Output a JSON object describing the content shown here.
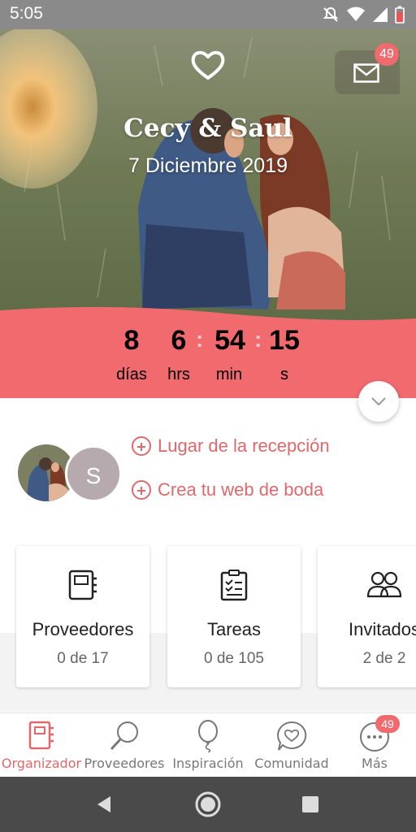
{
  "status_bar": {
    "time": "5:05"
  },
  "hero": {
    "names": "Cecy & Saul",
    "date": "7 Diciembre 2019",
    "mail_badge": "49"
  },
  "countdown": {
    "days": "8",
    "days_label": "días",
    "hours": "6",
    "hours_label": "hrs",
    "minutes": "54",
    "minutes_label": "min",
    "seconds": "15",
    "seconds_label": "s",
    "separator": ":"
  },
  "avatar_initial": "S",
  "links": [
    {
      "label": "Lugar de la recepción"
    },
    {
      "label": "Crea tu web de boda"
    }
  ],
  "cards": [
    {
      "title": "Proveedores",
      "count": "0 de 17",
      "icon": "notebook-icon"
    },
    {
      "title": "Tareas",
      "count": "0 de 105",
      "icon": "checklist-icon"
    },
    {
      "title": "Invitados",
      "count": "2 de 2",
      "icon": "guests-icon"
    }
  ],
  "bottom_nav": [
    {
      "label": "Organizador",
      "icon": "organizer-icon",
      "active": true
    },
    {
      "label": "Proveedores",
      "icon": "magnifier-icon"
    },
    {
      "label": "Inspiración",
      "icon": "balloon-icon"
    },
    {
      "label": "Comunidad",
      "icon": "chat-heart-icon"
    },
    {
      "label": "Más",
      "icon": "more-icon",
      "badge": "49"
    }
  ],
  "colors": {
    "accent": "#f06a6e",
    "link": "#e0686b"
  }
}
